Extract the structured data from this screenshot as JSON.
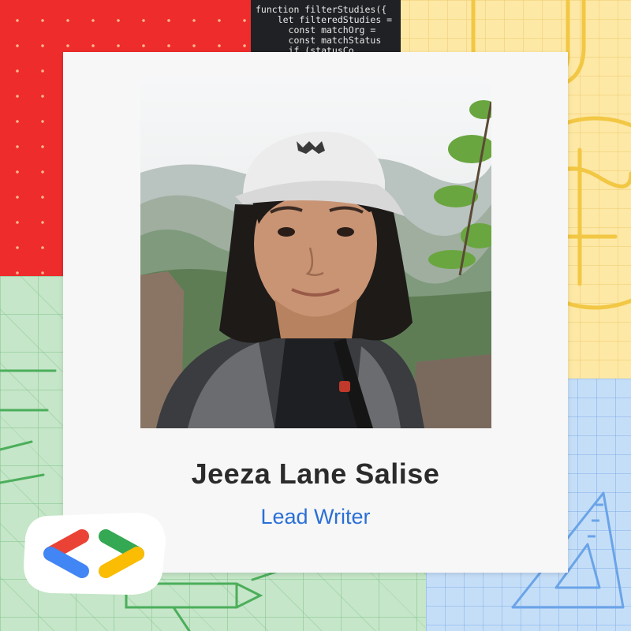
{
  "background": {
    "code_lines": [
      "function filterStudies({",
      "    let filteredStudies =",
      "      const matchOrg = ",
      "      const matchStatus",
      "      if (statusCo"
    ]
  },
  "card": {
    "name": "Jeeza Lane Salise",
    "role": "Lead Writer"
  },
  "colors": {
    "red_panel": "#ee2c2c",
    "yellow_panel": "#fde8a5",
    "green_panel": "#c5e6c8",
    "blue_panel": "#c5def8",
    "role_text": "#2a6fd6",
    "name_text": "#2b2b2b",
    "logo_red": "#ea4335",
    "logo_blue": "#4285f4",
    "logo_green": "#34a853",
    "logo_yellow": "#fbbc04"
  },
  "logo": {
    "icon": "google-developers-brackets-icon"
  }
}
